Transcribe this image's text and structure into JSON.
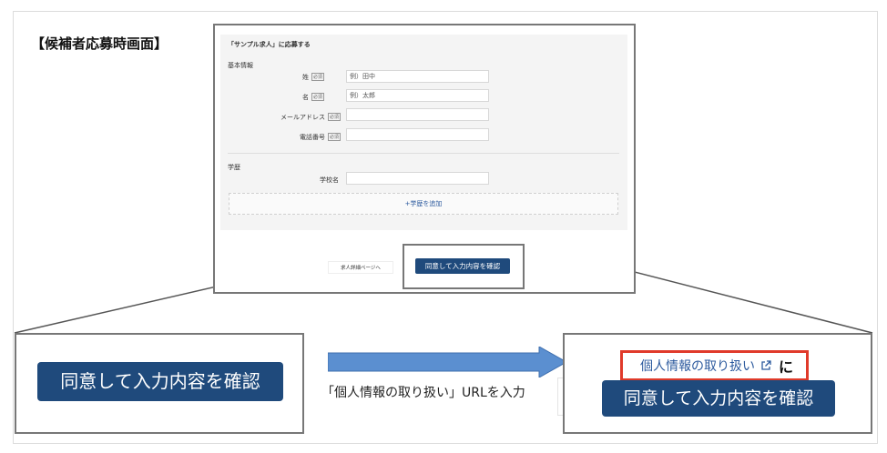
{
  "page": {
    "heading": "【候補者応募時画面】"
  },
  "form": {
    "title": "「サンプル求人」に応募する",
    "basic_section": "基本情報",
    "fields": [
      {
        "label": "姓",
        "required": "必須",
        "value": "例）田中"
      },
      {
        "label": "名",
        "required": "必須",
        "value": "例）太郎"
      },
      {
        "label": "メールアドレス",
        "required": "必須",
        "value": ""
      },
      {
        "label": "電話番号",
        "required": "必須",
        "value": ""
      }
    ],
    "education_section": "学歴",
    "school_label": "学校名",
    "school_value": "",
    "add_education": "+学歴を追加",
    "back_button": "求人詳細ページへ",
    "confirm_button": "同意して入力内容を確認"
  },
  "before": {
    "confirm_button": "同意して入力内容を確認"
  },
  "arrow_caption": "「個人情報の取り扱い」URLを入力",
  "after": {
    "privacy_link": "個人情報の取り扱い",
    "particle": "に",
    "confirm_button": "同意して入力内容を確認"
  },
  "colors": {
    "button_blue": "#1f4a7c",
    "link_blue": "#2c5a9e",
    "highlight_red": "#e03a2a",
    "arrow_blue": "#5b8fd0"
  }
}
